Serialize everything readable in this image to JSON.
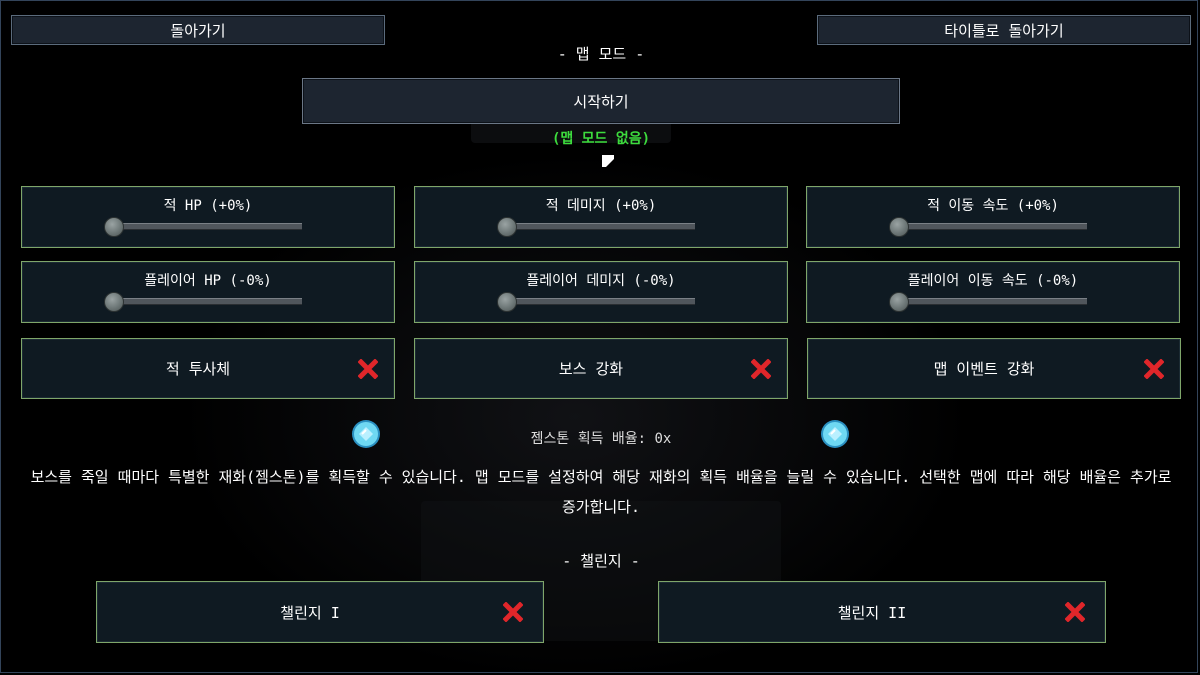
{
  "top_bar": {
    "back_label": "돌아가기",
    "title_label": "타이틀로 돌아가기"
  },
  "map_mode": {
    "section_title": "- 맵 모드 -",
    "start_label": "시작하기",
    "status": "(맵 모드 없음)"
  },
  "sliders": [
    {
      "label": "적 HP (+0%)",
      "value_percent": 0
    },
    {
      "label": "적 데미지 (+0%)",
      "value_percent": 0
    },
    {
      "label": "적 이동 속도 (+0%)",
      "value_percent": 0
    },
    {
      "label": "플레이어 HP (-0%)",
      "value_percent": 0
    },
    {
      "label": "플레이어 데미지 (-0%)",
      "value_percent": 0
    },
    {
      "label": "플레이어 이동 속도 (-0%)",
      "value_percent": 0
    }
  ],
  "toggles": [
    {
      "label": "적 투사체",
      "enabled": false,
      "icon": "red-x-icon"
    },
    {
      "label": "보스 강화",
      "enabled": false,
      "icon": "red-x-icon"
    },
    {
      "label": "맵 이벤트 강화",
      "enabled": false,
      "icon": "red-x-icon"
    }
  ],
  "gemstone": {
    "rate_text": "젬스톤 획득 배율: 0x",
    "icon": "gem-icon"
  },
  "description": "보스를 죽일 때마다 특별한 재화(젬스톤)를 획득할 수 있습니다. 맵 모드를 설정하여 해당 재화의 획득 배율을 늘릴 수 있습니다. 선택한 맵에 따라 해당 배율은 추가로 증가합니다.",
  "challenge": {
    "section_title": "- 챌린지 -",
    "items": [
      {
        "label": "챌린지 I",
        "enabled": false,
        "icon": "red-x-icon"
      },
      {
        "label": "챌린지 II",
        "enabled": false,
        "icon": "red-x-icon"
      }
    ]
  },
  "colors": {
    "panel_border": "#7fa66a",
    "status_green": "#3ddc3d",
    "x_red": "#e0262a",
    "gem_blue": "#6fd8f2"
  }
}
